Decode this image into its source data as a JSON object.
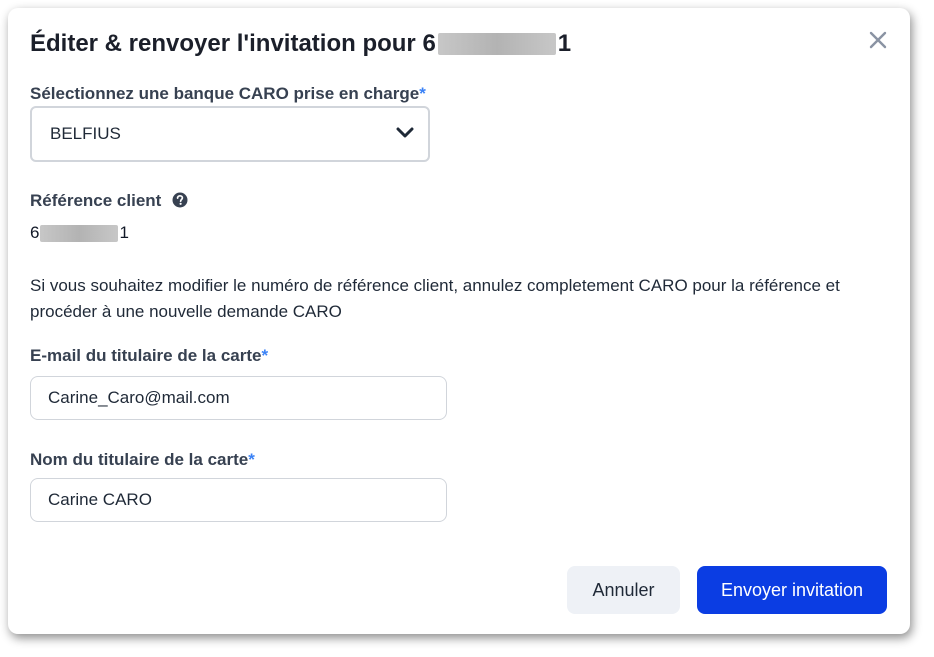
{
  "dialog": {
    "title_prefix": "Éditer & renvoyer l'invitation pour 6",
    "title_suffix": "1",
    "close_icon": "close-icon"
  },
  "bank": {
    "label": "Sélectionnez une banque CARO prise en charge",
    "required_mark": "*",
    "selected": "BELFIUS",
    "chevron_icon": "chevron-down-icon"
  },
  "reference": {
    "label": "Référence client",
    "help_icon": "question-circle-icon",
    "value_prefix": "6",
    "value_suffix": "1"
  },
  "info_text": "Si vous souhaitez modifier le numéro de référence client, annulez completement CARO pour la référence et procéder à une nouvelle demande CARO",
  "email": {
    "label": "E-mail du titulaire de la carte",
    "required_mark": "*",
    "value": "Carine_Caro@mail.com"
  },
  "name": {
    "label": "Nom du titulaire de la carte",
    "required_mark": "*",
    "value": "Carine CARO"
  },
  "actions": {
    "cancel_label": "Annuler",
    "send_label": "Envoyer invitation"
  },
  "colors": {
    "primary": "#0b3de3",
    "required": "#3b82f6",
    "secondary_bg": "#eef1f6"
  }
}
